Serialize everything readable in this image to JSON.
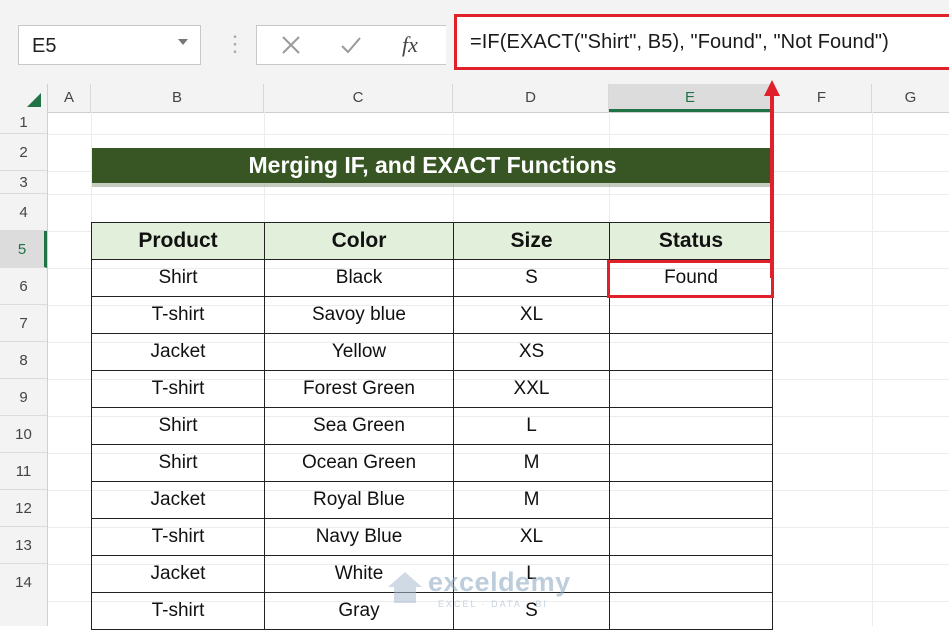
{
  "formula_bar": {
    "name_box": "E5",
    "formula": "=IF(EXACT(\"Shirt\", B5), \"Found\", \"Not Found\")",
    "icons": [
      "dropdown-icon",
      "more-dots-icon",
      "cancel-x-icon",
      "enter-check-icon",
      "insert-function-icon"
    ]
  },
  "columns": [
    "A",
    "B",
    "C",
    "D",
    "E",
    "F",
    "G"
  ],
  "rows": [
    "1",
    "2",
    "3",
    "4",
    "5",
    "6",
    "7",
    "8",
    "9",
    "10",
    "11",
    "12",
    "13",
    "14"
  ],
  "selected": {
    "column": "E",
    "row": "5"
  },
  "title": "Merging IF, and EXACT Functions",
  "table": {
    "headers": [
      "Product",
      "Color",
      "Size",
      "Status"
    ],
    "rows": [
      [
        "Shirt",
        "Black",
        "S",
        "Found"
      ],
      [
        "T-shirt",
        "Savoy blue",
        "XL",
        ""
      ],
      [
        "Jacket",
        "Yellow",
        "XS",
        ""
      ],
      [
        "T-shirt",
        "Forest Green",
        "XXL",
        ""
      ],
      [
        "Shirt",
        "Sea Green",
        "L",
        ""
      ],
      [
        "Shirt",
        "Ocean Green",
        "M",
        ""
      ],
      [
        "Jacket",
        "Royal Blue",
        "M",
        ""
      ],
      [
        "T-shirt",
        "Navy Blue",
        "XL",
        ""
      ],
      [
        "Jacket",
        "White",
        "L",
        ""
      ],
      [
        "T-shirt",
        "Gray",
        "S",
        ""
      ]
    ]
  },
  "watermark": {
    "name": "exceldemy",
    "tagline": "EXCEL · DATA · BI"
  },
  "colors": {
    "title_bg": "#375623",
    "header_bg": "#e2efda",
    "highlight": "#e0202a",
    "excel_green": "#217346"
  }
}
